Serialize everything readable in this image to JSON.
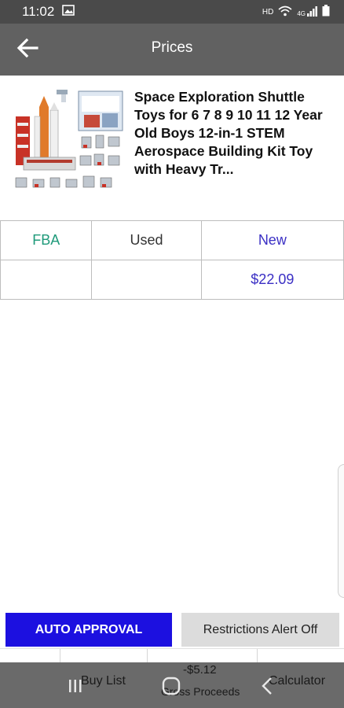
{
  "status_bar": {
    "time": "11:02",
    "network": "HD",
    "signal": "4G"
  },
  "header": {
    "title": "Prices"
  },
  "product": {
    "name": "Space Exploration Shuttle Toys for 6 7 8 9 10 11 12 Year Old Boys 12-in-1 STEM Aerospace Building Kit Toy with Heavy Tr..."
  },
  "prices_table": {
    "headers": [
      "FBA",
      "Used",
      "New"
    ],
    "rows": [
      [
        "",
        "",
        "$22.09"
      ]
    ]
  },
  "buttons": {
    "auto_approval": "AUTO APPROVAL",
    "restrictions": "Restrictions Alert Off"
  },
  "bottom_nav": {
    "buy_list": "Buy List",
    "gross_proceeds_value": "-$5.12",
    "gross_proceeds_label": "Gross Proceeds",
    "calculator": "Calculator"
  }
}
